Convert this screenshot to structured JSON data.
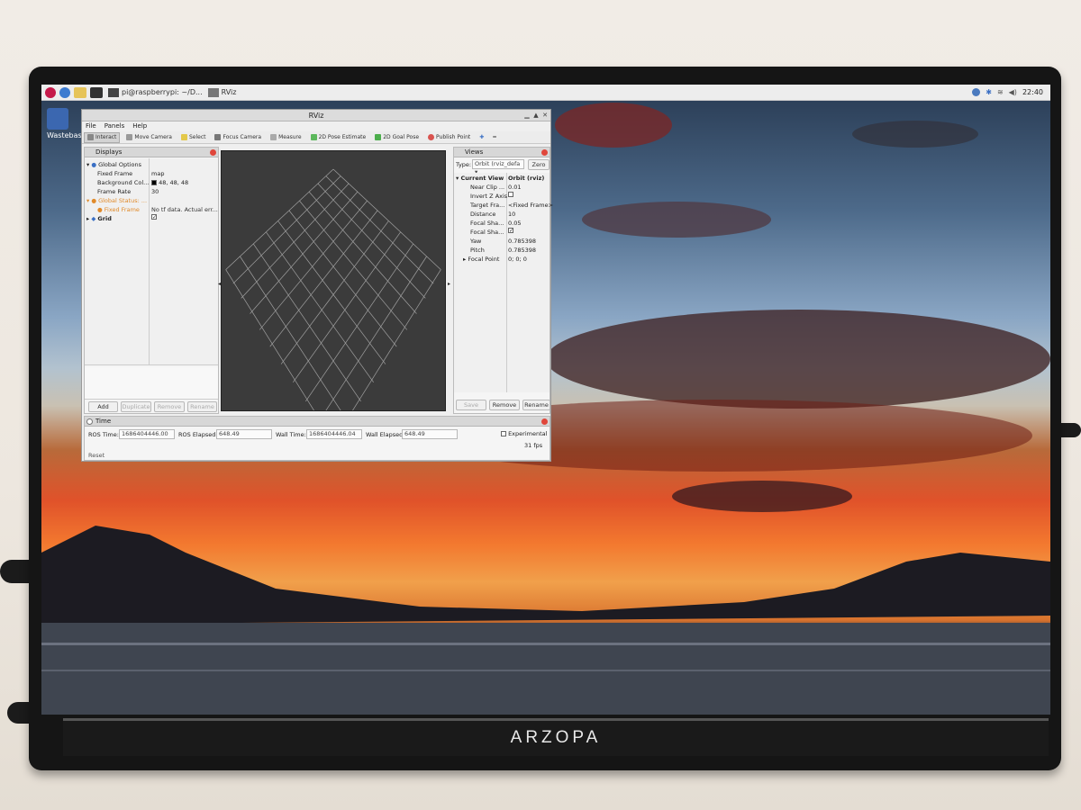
{
  "desktop": {
    "taskbar": {
      "tasks": [
        "pi@raspberrypi: ~/D...",
        "RViz"
      ],
      "clock": "22:40"
    },
    "desktop_icon_label": "Wastebasket"
  },
  "monitor": {
    "brand": "ARZOPA"
  },
  "rviz": {
    "window_title": "RViz",
    "menu": [
      "File",
      "Panels",
      "Help"
    ],
    "tools": [
      "Interact",
      "Move Camera",
      "Select",
      "Focus Camera",
      "Measure",
      "2D Pose Estimate",
      "2D Goal Pose",
      "Publish Point"
    ],
    "displays": {
      "title": "Displays",
      "rows": [
        {
          "name": "Global Options",
          "value": ""
        },
        {
          "name": "Fixed Frame",
          "value": "map"
        },
        {
          "name": "Background Col...",
          "value": "48, 48, 48"
        },
        {
          "name": "Frame Rate",
          "value": "30"
        },
        {
          "name": "Global Status: ...",
          "value": ""
        },
        {
          "name": "Fixed Frame",
          "value": "No tf data.  Actual err..."
        },
        {
          "name": "Grid",
          "value": "✓"
        }
      ],
      "buttons": [
        "Add",
        "Duplicate",
        "Remove",
        "Rename"
      ]
    },
    "views": {
      "title": "Views",
      "type_label": "Type:",
      "type_value": "Orbit (rviz_defa",
      "zero_label": "Zero",
      "rows": [
        {
          "name": "Current View",
          "value": "Orbit (rviz)"
        },
        {
          "name": "Near Clip ...",
          "value": "0.01"
        },
        {
          "name": "Invert Z Axis",
          "value": ""
        },
        {
          "name": "Target Fra...",
          "value": "<Fixed Frame>"
        },
        {
          "name": "Distance",
          "value": "10"
        },
        {
          "name": "Focal Sha...",
          "value": "0.05"
        },
        {
          "name": "Focal Sha...",
          "value": "✓"
        },
        {
          "name": "Yaw",
          "value": "0.785398"
        },
        {
          "name": "Pitch",
          "value": "0.785398"
        },
        {
          "name": "Focal Point",
          "value": "0; 0; 0"
        }
      ],
      "buttons": [
        "Save",
        "Remove",
        "Rename"
      ]
    },
    "time": {
      "title": "Time",
      "ros_time_label": "ROS Time:",
      "ros_time": "1686404446.00",
      "ros_elapsed_label": "ROS Elapsed:",
      "ros_elapsed": "648.49",
      "wall_time_label": "Wall Time:",
      "wall_time": "1686404446.04",
      "wall_elapsed_label": "Wall Elapsed:",
      "wall_elapsed": "648.49",
      "experimental_label": "Experimental",
      "fps": "31 fps",
      "reset_label": "Reset"
    }
  },
  "colors": {
    "background_swatch": "#000000",
    "status_warn": "#e08a2a",
    "grid_line": "#a0a0a0"
  }
}
